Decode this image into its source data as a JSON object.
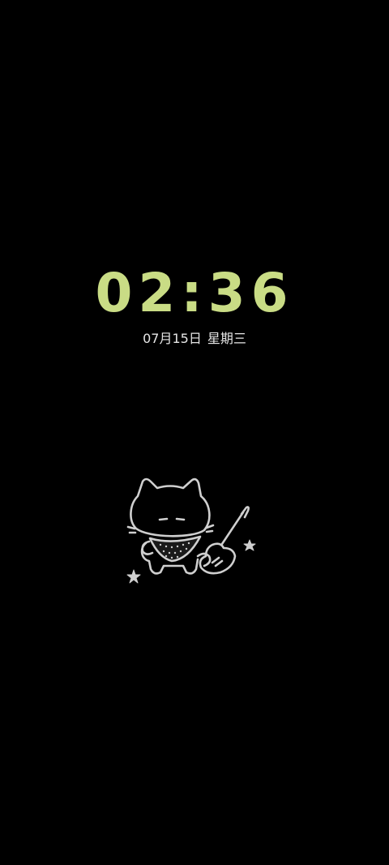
{
  "aod": {
    "time": "02:36",
    "date": "07月15日",
    "weekday": "星期三",
    "time_color": "#c9dc85",
    "date_color": "#e6e6e6",
    "sticker_color": "#cfcfcf",
    "sticker_icon": "cat-with-guitar-icon"
  }
}
